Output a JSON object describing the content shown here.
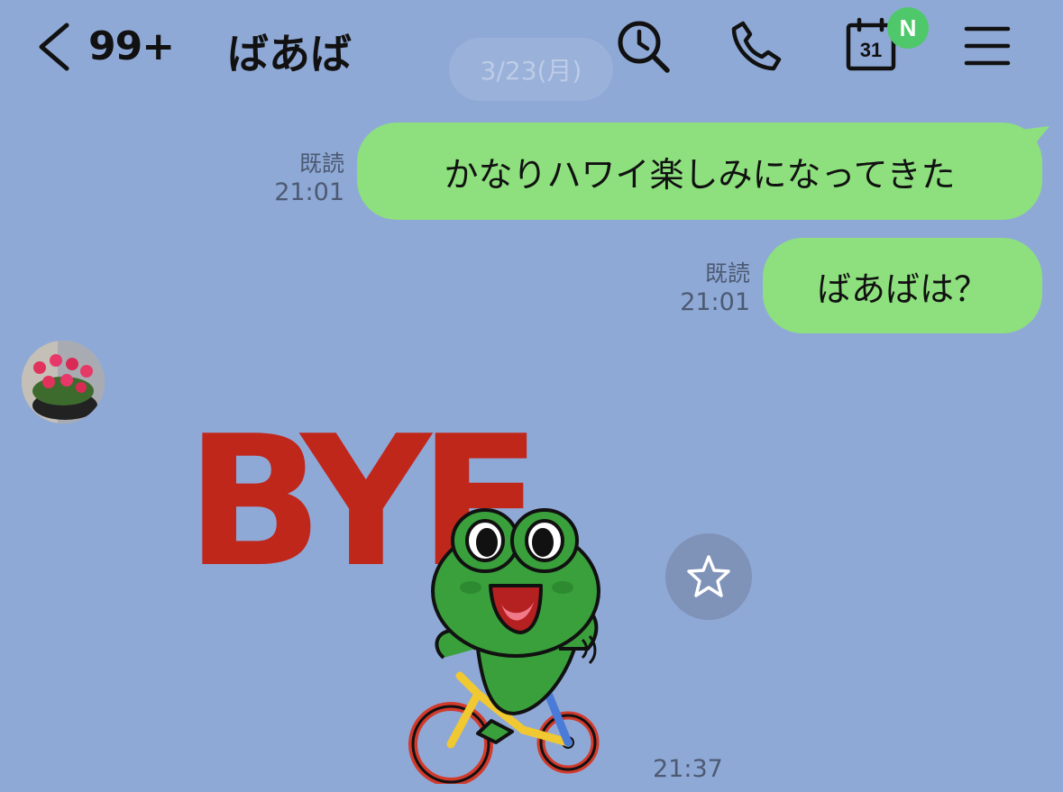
{
  "header": {
    "unread_count": "99+",
    "chat_name": "ばあば",
    "calendar_day": "31",
    "calendar_badge": "N",
    "icons": [
      "back-chevron-icon",
      "search-history-icon",
      "phone-icon",
      "calendar-icon",
      "menu-icon"
    ]
  },
  "date_separator": "3/23(月)",
  "messages": [
    {
      "text": "かなりハワイ楽しみになってきた",
      "read_label": "既読",
      "time": "21:01"
    },
    {
      "text": "ばあばは？",
      "read_label": "既読",
      "time": "21:01"
    }
  ],
  "sticker": {
    "text": "BYE",
    "time": "21:37",
    "favorite_icon": "star-icon"
  },
  "colors": {
    "background": "#8fa9d6",
    "bubble": "#8de07d",
    "badge": "#4fc86b",
    "sticker_text": "#c0271b",
    "frog": "#3aa03c"
  }
}
